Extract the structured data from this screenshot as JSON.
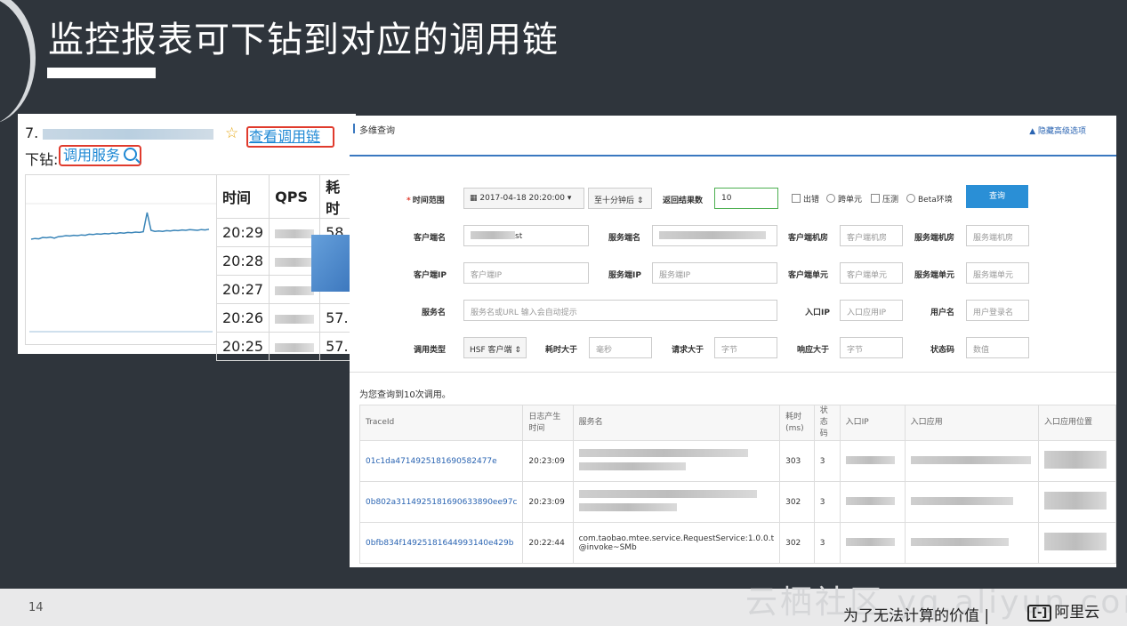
{
  "slide": {
    "title": "监控报表可下钻到对应的调用链",
    "page_number": "14",
    "watermark": "云栖社区 yq.aliyun.com",
    "slogan": "为了无法计算的价值 | ",
    "brand": "阿里云",
    "brand_logo": "[-]"
  },
  "left_panel": {
    "prefix": "7.",
    "star_icon": "☆",
    "view_trace_link": "查看调用链",
    "drill_label": "下钻:",
    "drill_link": "调用服务",
    "columns": [
      "时间",
      "QPS",
      "耗时"
    ],
    "rows": [
      {
        "time": "20:29",
        "cost": "58."
      },
      {
        "time": "20:28",
        "cost": ""
      },
      {
        "time": "20:27",
        "cost": ""
      },
      {
        "time": "20:26",
        "cost": "57."
      },
      {
        "time": "20:25",
        "cost": "57."
      }
    ],
    "sparkline": [
      0.2,
      0.22,
      0.21,
      0.25,
      0.24,
      0.26,
      0.23,
      0.27,
      0.28,
      0.3,
      0.29,
      0.31,
      0.3,
      0.32,
      0.31,
      0.34,
      0.33,
      0.35,
      0.34,
      0.36,
      0.35,
      0.37,
      0.36,
      0.38,
      0.37,
      0.39,
      0.38,
      0.4,
      0.39,
      0.41,
      0.95,
      0.45,
      0.42,
      0.43,
      0.42,
      0.44,
      0.43,
      0.45,
      0.44,
      0.46,
      0.45,
      0.47,
      0.46,
      0.45,
      0.47,
      0.46,
      0.48
    ]
  },
  "query_panel": {
    "title": "多维查询",
    "hide_advanced": "隐藏高级选项",
    "time_range_label": "时间范围",
    "date_value": "2017-04-18 20:20:00",
    "duration_value": "至十分钟后",
    "return_count_label": "返回结果数",
    "return_count_value": "10",
    "checkboxes": [
      "出错",
      "跨单元",
      "压测",
      "Beta环境"
    ],
    "query_button": "查询",
    "client_name_label": "客户端名",
    "client_name_value": "st",
    "server_name_label": "服务端名",
    "client_room_label": "客户端机房",
    "client_room_placeholder": "客户端机房",
    "server_room_label": "服务端机房",
    "server_room_placeholder": "服务端机房",
    "client_ip_label": "客户端IP",
    "client_ip_placeholder": "客户端IP",
    "server_ip_label": "服务端IP",
    "server_ip_placeholder": "服务端IP",
    "client_unit_label": "客户端单元",
    "client_unit_placeholder": "客户端单元",
    "server_unit_label": "服务端单元",
    "server_unit_placeholder": "服务端单元",
    "service_name_label": "服务名",
    "service_name_placeholder": "服务名或URL 输入会自动提示",
    "entry_ip_label": "入口IP",
    "entry_ip_placeholder": "入口应用IP",
    "username_label": "用户名",
    "username_placeholder": "用户登录名",
    "call_type_label": "调用类型",
    "call_type_value": "HSF 客户端",
    "cost_gt_label": "耗时大于",
    "cost_gt_placeholder": "毫秒",
    "req_gt_label": "请求大于",
    "req_gt_placeholder": "字节",
    "resp_gt_label": "响应大于",
    "resp_gt_placeholder": "字节",
    "status_code_label": "状态码",
    "status_code_placeholder": "数值",
    "result_count_text": "为您查询到10次调用。",
    "columns": {
      "traceid": "TraceId",
      "log_time": "日志产生时间",
      "service": "服务名",
      "cost": "耗时(ms)",
      "status": "状态码",
      "entry_ip": "入口IP",
      "entry_app": "入口应用",
      "entry_loc": "入口应用位置"
    },
    "rows": [
      {
        "traceid": "01c1da4714925181690582477e",
        "time": "20:23:09",
        "service": "",
        "service2": "",
        "cost": "303",
        "status": "3"
      },
      {
        "traceid": "0b802a3114925181690633890ee97c",
        "time": "20:23:09",
        "service": "",
        "service2": "",
        "cost": "302",
        "status": "3"
      },
      {
        "traceid": "0bfb834f14925181644993140e429b",
        "time": "20:22:44",
        "service": "com.taobao.mtee.service.RequestService:1.0.0.t",
        "service2": "@invoke~SMb",
        "cost": "302",
        "status": "3"
      }
    ]
  }
}
